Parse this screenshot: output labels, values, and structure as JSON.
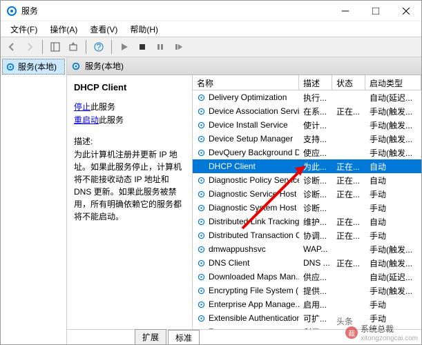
{
  "window": {
    "title": "服务"
  },
  "menu": {
    "file": "文件(F)",
    "action": "操作(A)",
    "view": "查看(V)",
    "help": "帮助(H)"
  },
  "tree": {
    "root": "服务(本地)"
  },
  "rightHeader": {
    "label": "服务(本地)"
  },
  "detail": {
    "title": "DHCP Client",
    "stopLink": "停止",
    "stopSuffix": "此服务",
    "restartLink": "重启动",
    "restartSuffix": "此服务",
    "descLabel": "描述:",
    "descText": "为此计算机注册并更新 IP 地址。如果此服务停止，计算机将不能接收动态 IP 地址和 DNS 更新。如果此服务被禁用，所有明确依赖它的服务都将不能启动。"
  },
  "columns": {
    "name": "名称",
    "desc": "描述",
    "status": "状态",
    "startup": "启动类型"
  },
  "rows": [
    {
      "name": "Delivery Optimization",
      "desc": "执行...",
      "status": "",
      "startup": "自动(延迟...",
      "sel": false
    },
    {
      "name": "Device Association Service",
      "desc": "在系...",
      "status": "正在...",
      "startup": "手动(触发...",
      "sel": false
    },
    {
      "name": "Device Install Service",
      "desc": "使计...",
      "status": "",
      "startup": "手动(触发...",
      "sel": false
    },
    {
      "name": "Device Setup Manager",
      "desc": "支持...",
      "status": "",
      "startup": "手动(触发...",
      "sel": false
    },
    {
      "name": "DevQuery Background D...",
      "desc": "使应...",
      "status": "",
      "startup": "手动(触发...",
      "sel": false
    },
    {
      "name": "DHCP Client",
      "desc": "为此...",
      "status": "正在...",
      "startup": "自动",
      "sel": true
    },
    {
      "name": "Diagnostic Policy Service",
      "desc": "诊断...",
      "status": "正在...",
      "startup": "自动",
      "sel": false
    },
    {
      "name": "Diagnostic Service Host",
      "desc": "诊断...",
      "status": "正在...",
      "startup": "手动",
      "sel": false
    },
    {
      "name": "Diagnostic System Host",
      "desc": "诊断...",
      "status": "",
      "startup": "手动",
      "sel": false
    },
    {
      "name": "Distributed Link Tracking...",
      "desc": "维护...",
      "status": "正在...",
      "startup": "自动",
      "sel": false
    },
    {
      "name": "Distributed Transaction C...",
      "desc": "协调...",
      "status": "正在...",
      "startup": "手动",
      "sel": false
    },
    {
      "name": "dmwappushsvc",
      "desc": "WAP...",
      "status": "",
      "startup": "手动(触发...",
      "sel": false
    },
    {
      "name": "DNS Client",
      "desc": "DNS ...",
      "status": "正在...",
      "startup": "自动(触发...",
      "sel": false
    },
    {
      "name": "Downloaded Maps Man...",
      "desc": "供应...",
      "status": "",
      "startup": "自动(延迟...",
      "sel": false
    },
    {
      "name": "Encrypting File System (E...",
      "desc": "提供...",
      "status": "",
      "startup": "手动(触发...",
      "sel": false
    },
    {
      "name": "Enterprise App Manage...",
      "desc": "启用...",
      "status": "",
      "startup": "手动",
      "sel": false
    },
    {
      "name": "Extensible Authentication...",
      "desc": "可扩...",
      "status": "",
      "startup": "手动",
      "sel": false
    },
    {
      "name": "Fax",
      "desc": "利用...",
      "status": "",
      "startup": "手动",
      "sel": false
    }
  ],
  "tabs": {
    "extended": "扩展",
    "standard": "标准"
  },
  "watermark": {
    "brand": "头条",
    "name": "系统总裁",
    "url": "xitongzongcai.com"
  }
}
